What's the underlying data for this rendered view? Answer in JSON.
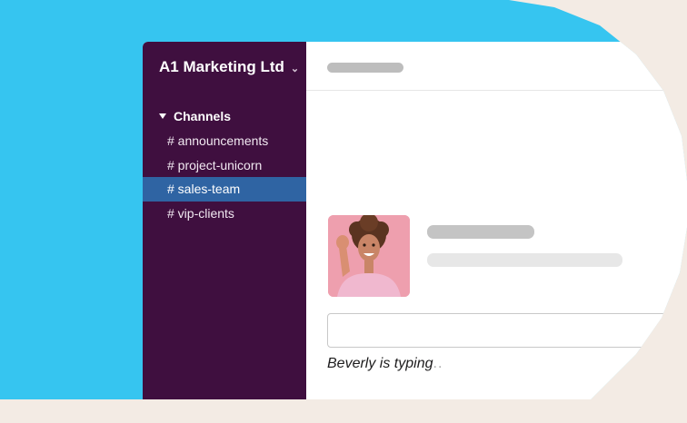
{
  "workspace": {
    "name": "A1 Marketing Ltd",
    "chevron_glyph": "⌄"
  },
  "sidebar": {
    "section_label": "Channels",
    "channels": [
      {
        "label": "# announcements",
        "active": false
      },
      {
        "label": "# project-unicorn",
        "active": false
      },
      {
        "label": "# sales-team",
        "active": true
      },
      {
        "label": "# vip-clients",
        "active": false
      }
    ]
  },
  "message": {
    "avatar_icon": "person-waving-avatar"
  },
  "typing_indicator": {
    "text": "Beverly is typing",
    "dots": ".."
  },
  "colors": {
    "sidebar_bg": "#3f0f3f",
    "active_channel": "#2f64a3",
    "backdrop_blue": "#36c5f0",
    "page_bg": "#f3ebe4"
  }
}
